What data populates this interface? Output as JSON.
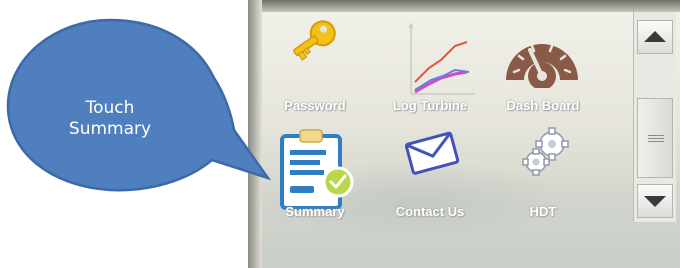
{
  "callout": {
    "line1": "Touch",
    "line2": "Summary"
  },
  "tiles": [
    {
      "label": "Password",
      "icon": "key-icon"
    },
    {
      "label": "Log Turbine",
      "icon": "line-chart-icon"
    },
    {
      "label": "Dash Board",
      "icon": "gauge-icon"
    },
    {
      "label": "Summary",
      "icon": "clipboard-check-icon"
    },
    {
      "label": "Contact Us",
      "icon": "envelope-icon"
    },
    {
      "label": "HDT",
      "icon": "gears-icon"
    }
  ],
  "scrollbar": {
    "up": "scroll-up-arrow",
    "down": "scroll-down-arrow"
  },
  "colors": {
    "bubble": "#4f7fbe",
    "bubble_border": "#3c6aa6",
    "dashboard_icon": "#8a5a48",
    "summary_icon": "#2f7ec4",
    "check_badge": "#b8d84a"
  }
}
